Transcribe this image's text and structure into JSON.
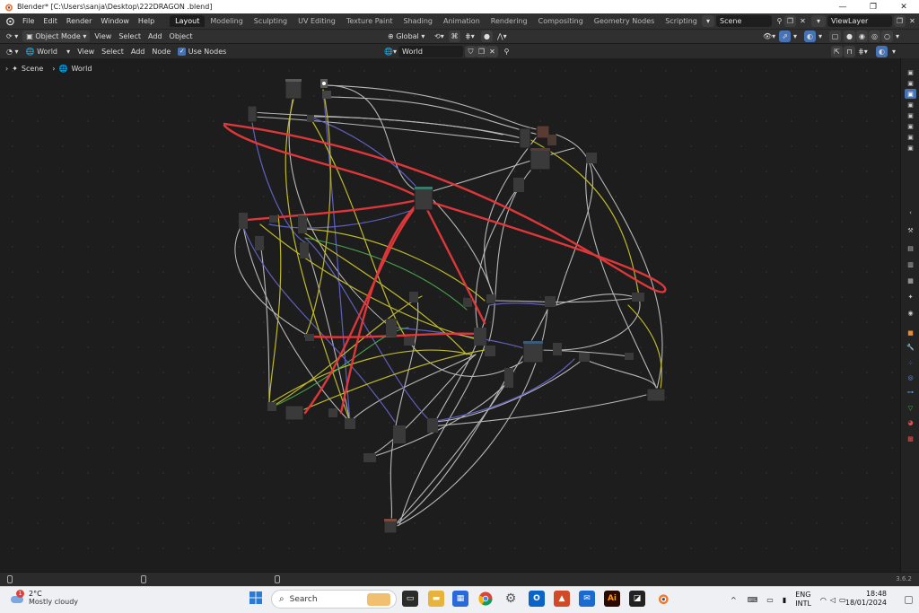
{
  "titlebar": {
    "title": "Blender* [C:\\Users\\sanja\\Desktop\\222DRAGON .blend]",
    "minimize": "—",
    "maximize": "❐",
    "close": "✕"
  },
  "menu": [
    "File",
    "Edit",
    "Render",
    "Window",
    "Help"
  ],
  "workspaces": [
    "Layout",
    "Modeling",
    "Sculpting",
    "UV Editing",
    "Texture Paint",
    "Shading",
    "Animation",
    "Rendering",
    "Compositing",
    "Geometry Nodes",
    "Scripting"
  ],
  "workspace_add": "+",
  "scene": {
    "name": "Scene",
    "view_layer": "ViewLayer"
  },
  "header": {
    "mode": "Object Mode",
    "view": "View",
    "select": "Select",
    "add": "Add",
    "object": "Object",
    "orientation": "Global"
  },
  "header2": {
    "shader_type": "World",
    "view": "View",
    "select": "Select",
    "add": "Add",
    "node": "Node",
    "use_nodes": "Use Nodes",
    "world_name": "World"
  },
  "breadcrumb": {
    "scene": "Scene",
    "world": "World"
  },
  "version": "3.6.2",
  "taskbar": {
    "temp": "2°C",
    "weather_badge": "1",
    "condition": "Mostly cloudy",
    "search": "Search",
    "lang": "ENG",
    "layout": "INTL",
    "time": "18:48",
    "date": "18/01/2024",
    "tray_arrow": "^"
  },
  "colors": {
    "accent": "#4772b3",
    "wire_default": "#c8c8c8",
    "wire_red": "#e8393c",
    "wire_yellow": "#c7c229",
    "wire_purple": "#6363c7",
    "wire_green": "#4fb24f"
  }
}
